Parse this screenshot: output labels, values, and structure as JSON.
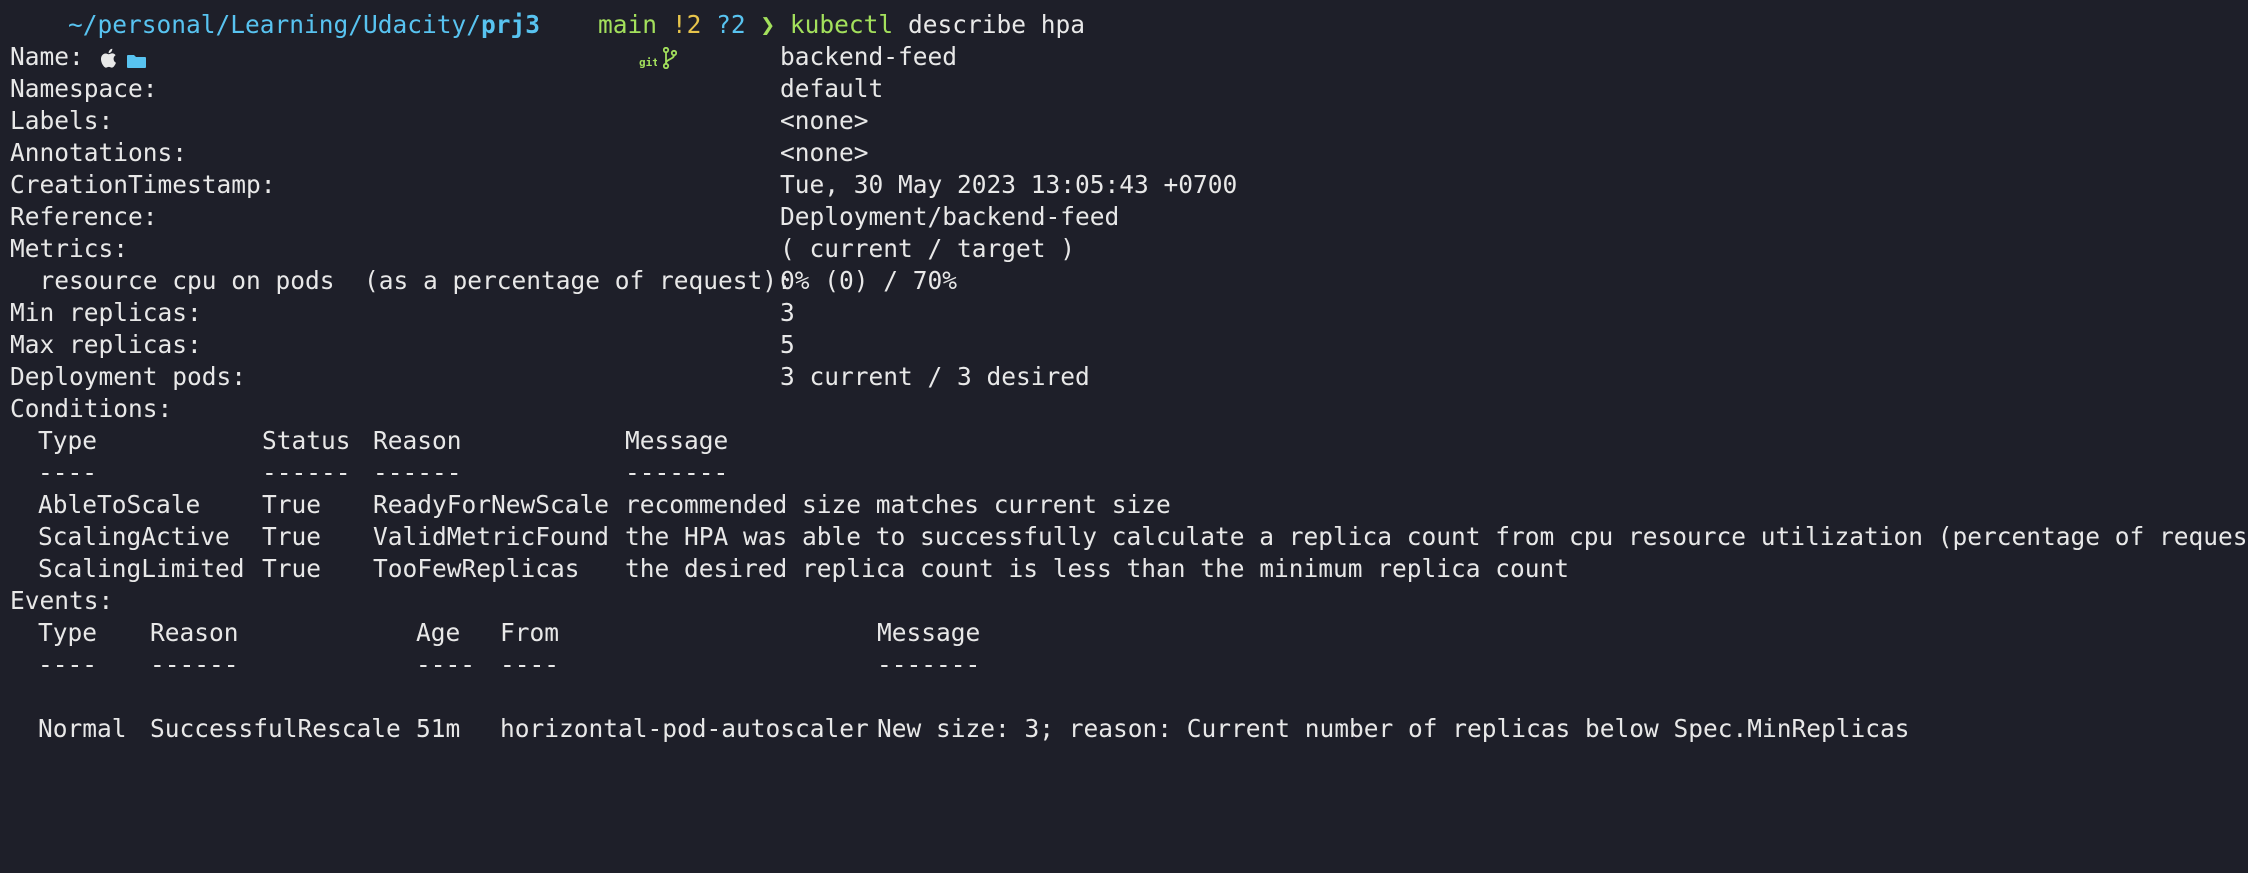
{
  "prompt": {
    "path": "~/personal/Learning/Udacity/",
    "cwd": "prj3",
    "git_label": "git",
    "branch": "main",
    "modified": "!2",
    "untracked": "?2",
    "arrow": "❯",
    "command": "kubectl",
    "args": "describe hpa"
  },
  "fields": [
    {
      "key": "Name:",
      "value": "backend-feed"
    },
    {
      "key": "Namespace:",
      "value": "default"
    },
    {
      "key": "Labels:",
      "value": "<none>"
    },
    {
      "key": "Annotations:",
      "value": "<none>"
    },
    {
      "key": "CreationTimestamp:",
      "value": "Tue, 30 May 2023 13:05:43 +0700"
    },
    {
      "key": "Reference:",
      "value": "Deployment/backend-feed"
    },
    {
      "key": "Metrics:",
      "value": "( current / target )"
    },
    {
      "key": "  resource cpu on pods  (as a percentage of request):",
      "value": "0% (0) / 70%"
    },
    {
      "key": "Min replicas:",
      "value": "3"
    },
    {
      "key": "Max replicas:",
      "value": "5"
    },
    {
      "key": "Deployment pods:",
      "value": "3 current / 3 desired"
    }
  ],
  "conditions": {
    "title": "Conditions:",
    "headers": {
      "type": "Type",
      "status": "Status",
      "reason": "Reason",
      "message": "Message"
    },
    "underline": {
      "type": "----",
      "status": "------",
      "reason": "------",
      "message": "-------"
    },
    "rows": [
      {
        "type": "AbleToScale",
        "status": "True",
        "reason": "ReadyForNewScale",
        "message": "recommended size matches current size"
      },
      {
        "type": "ScalingActive",
        "status": "True",
        "reason": "ValidMetricFound",
        "message": "the HPA was able to successfully calculate a replica count from cpu resource utilization (percentage of request)"
      },
      {
        "type": "ScalingLimited",
        "status": "True",
        "reason": "TooFewReplicas",
        "message": "the desired replica count is less than the minimum replica count"
      }
    ]
  },
  "events": {
    "title": "Events:",
    "headers": {
      "type": "Type",
      "reason": "Reason",
      "age": "Age",
      "from": "From",
      "message": "Message"
    },
    "underline": {
      "type": "----",
      "reason": "------",
      "age": "----",
      "from": "----",
      "message": "-------"
    },
    "rows": [
      {
        "type": "Normal",
        "reason": "SuccessfulRescale",
        "age": "51m",
        "from": "horizontal-pod-autoscaler",
        "message": "New size: 3; reason: Current number of replicas below Spec.MinReplicas"
      }
    ]
  },
  "colors": {
    "background": "#1e1f29",
    "text": "#e8e8e8",
    "path": "#58c3f0",
    "git": "#a3e05c",
    "modified": "#e7c44b"
  },
  "icons": [
    "apple-icon",
    "folder-icon",
    "git-icon",
    "branch-icon"
  ]
}
